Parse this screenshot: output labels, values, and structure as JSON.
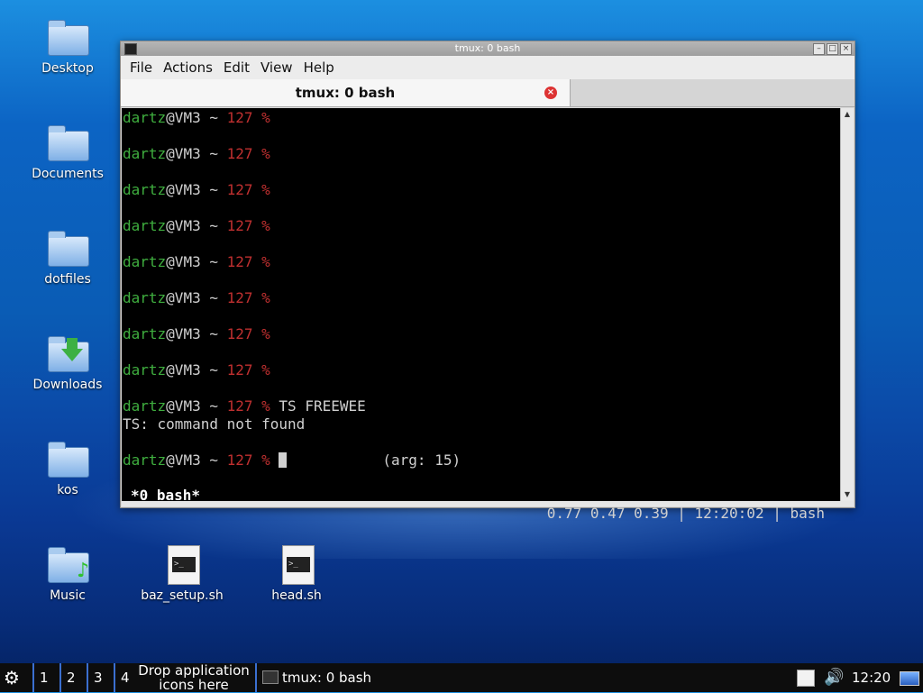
{
  "desktop": {
    "icons": [
      {
        "label": "Desktop"
      },
      {
        "label": "Documents"
      },
      {
        "label": "dotfiles"
      },
      {
        "label": "Downloads"
      },
      {
        "label": "kos"
      },
      {
        "label": "Music"
      },
      {
        "label": "baz_setup.sh"
      },
      {
        "label": "head.sh"
      }
    ]
  },
  "window": {
    "title": "tmux: 0 bash",
    "menu": [
      "File",
      "Actions",
      "Edit",
      "View",
      "Help"
    ],
    "tab": {
      "label": "tmux: 0 bash"
    },
    "terminal": {
      "prompt_user": "dartz",
      "prompt_host": "@VM3",
      "prompt_path": " ~ ",
      "prompt_code": "127 %",
      "cmd": "TS FREEWEE",
      "error": "TS: command not found",
      "arg": "(arg: 15)",
      "status_left": "*0 bash*",
      "status_right": "0.77 0.47 0.39 | 12:20:02 | bash"
    }
  },
  "taskbar": {
    "workspaces": [
      "1",
      "2",
      "3",
      "4"
    ],
    "drop_line1": "Drop application",
    "drop_line2": "icons here",
    "task_label": "tmux: 0 bash",
    "clock": "12:20"
  }
}
